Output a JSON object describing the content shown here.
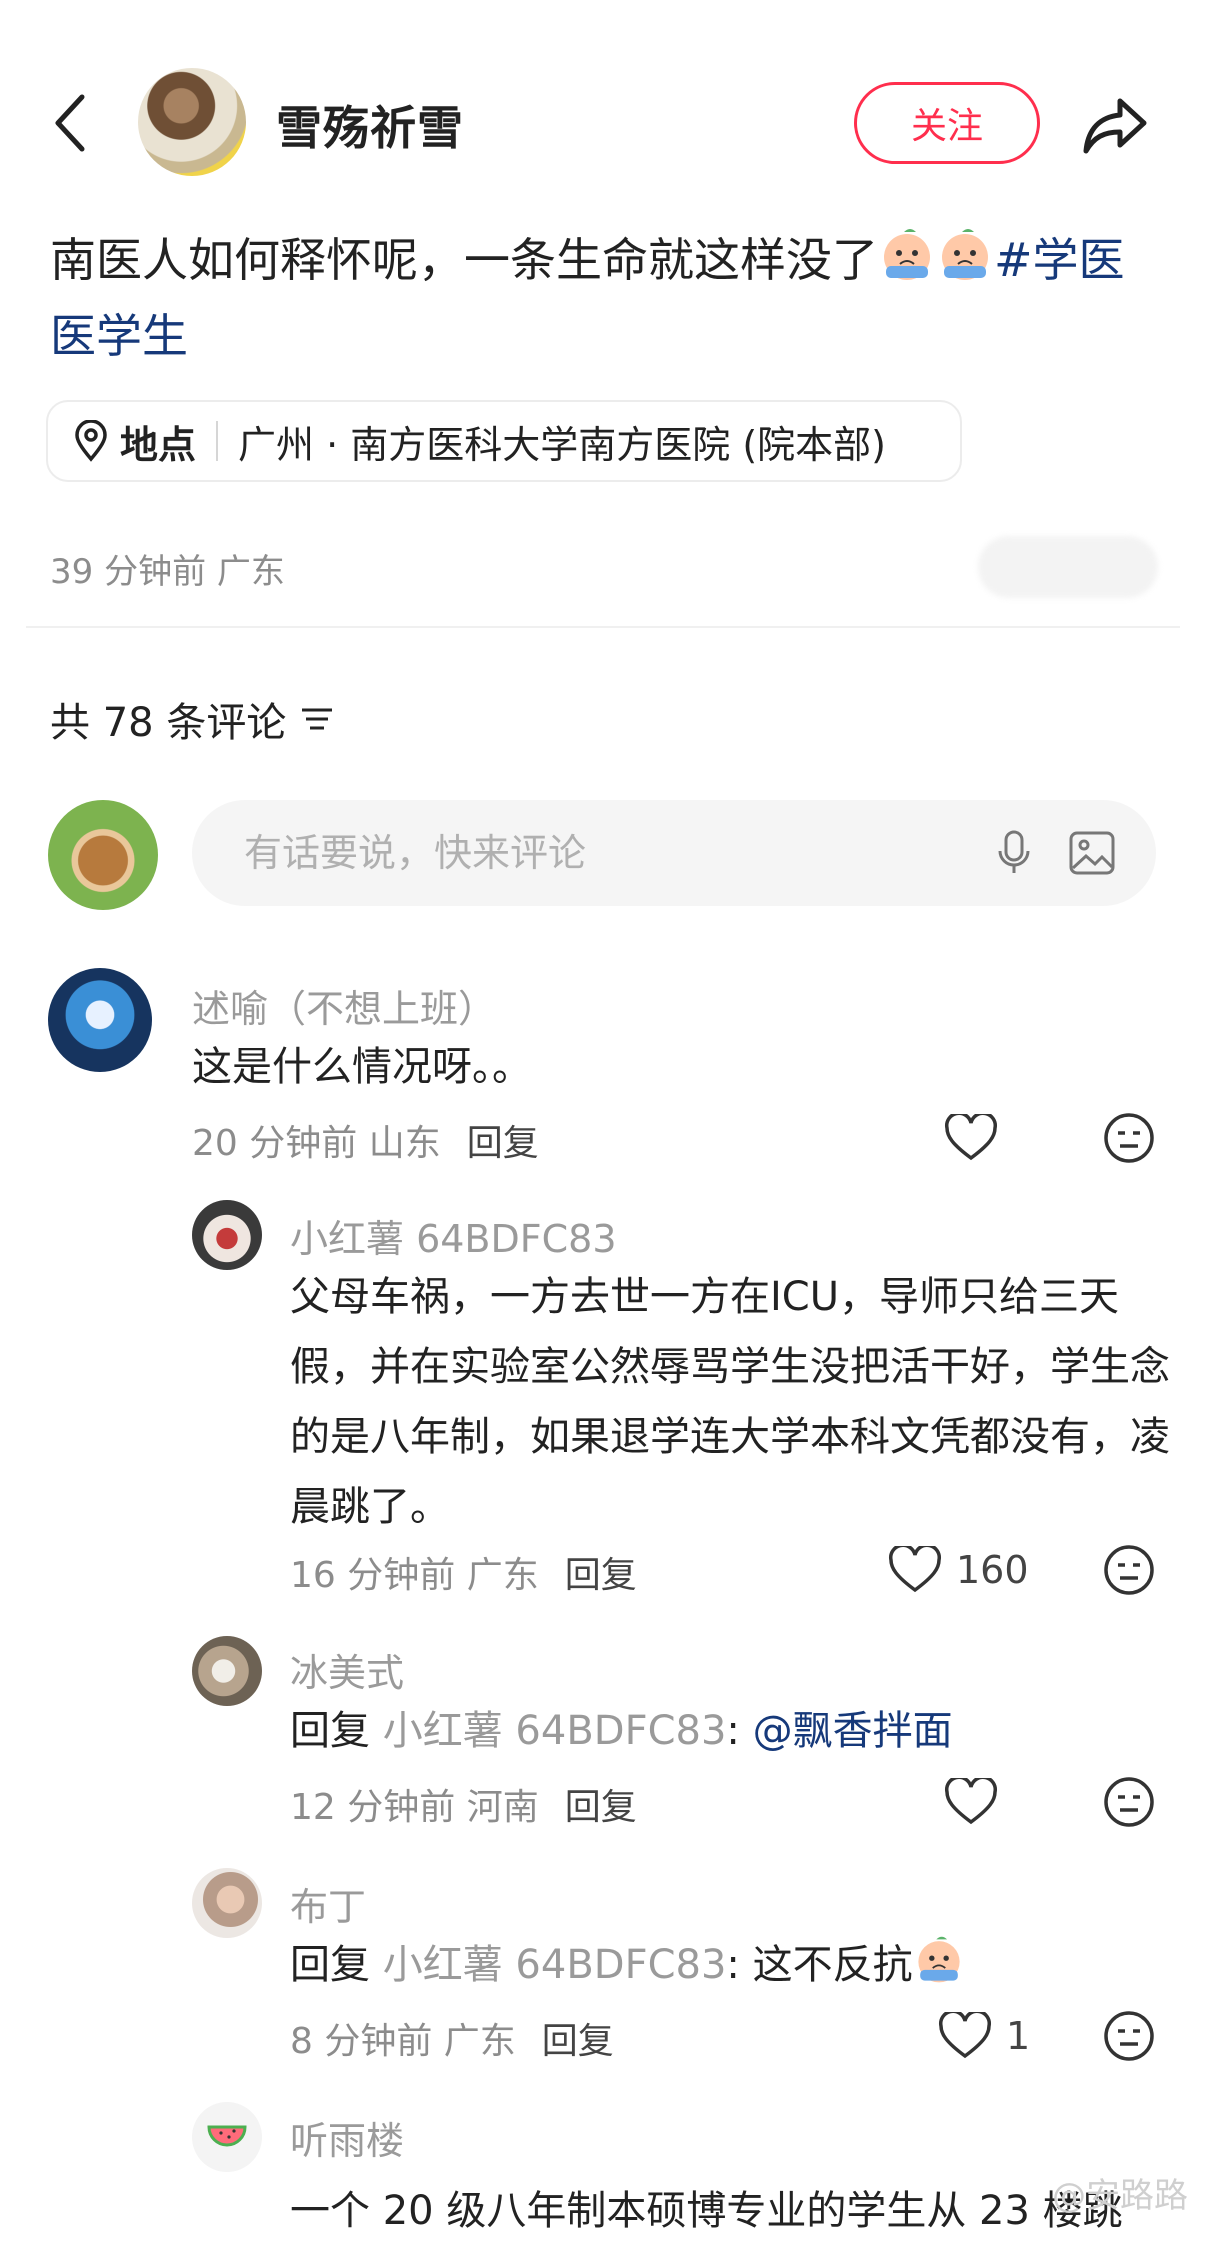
{
  "header": {
    "back_icon": "chevron-left-icon",
    "author_name": "雪殇祈雪",
    "follow_label": "关注",
    "share_icon": "share-arrow-icon"
  },
  "post": {
    "text": "南医人如何释怀呢，一条生命就这样没了",
    "hashtags": "#学医 医学生",
    "location_label": "地点",
    "location_value": "广州 · 南方医科大学南方医院 (院本部)",
    "time_region": "39 分钟前 广东"
  },
  "comments_header": {
    "count_text": "共 78 条评论"
  },
  "comment_input": {
    "placeholder": "有话要说，快来评论",
    "mic_icon": "microphone-icon",
    "image_icon": "image-icon"
  },
  "comments": [
    {
      "name": "述喻（不想上班）",
      "text": "这是什么情况呀。。",
      "time_region": "20 分钟前 山东",
      "reply_label": "回复",
      "likes": ""
    }
  ],
  "replies": [
    {
      "name": "小红薯 64BDFC83",
      "text": "父母车祸，一方去世一方在ICU，导师只给三天假，并在实验室公然辱骂学生没把活干好，学生念的是八年制，如果退学连大学本科文凭都没有，凌晨跳了。",
      "time_region": "16 分钟前 广东",
      "reply_label": "回复",
      "likes": "160"
    },
    {
      "name": "冰美式",
      "reply_prefix": "回复",
      "reply_to": "小红薯 64BDFC83",
      "text": "@飘香拌面",
      "time_region": "12 分钟前 河南",
      "reply_label": "回复",
      "likes": ""
    },
    {
      "name": "布丁",
      "reply_prefix": "回复",
      "reply_to": "小红薯 64BDFC83",
      "text": "这不反抗",
      "time_region": "8 分钟前 广东",
      "reply_label": "回复",
      "likes": "1"
    },
    {
      "name": "听雨楼",
      "text": "一个 20 级八年制本硕博专业的学生从 23 楼跳",
      "time_region": "",
      "reply_label": "",
      "likes": ""
    }
  ],
  "watermark": "@安路路"
}
